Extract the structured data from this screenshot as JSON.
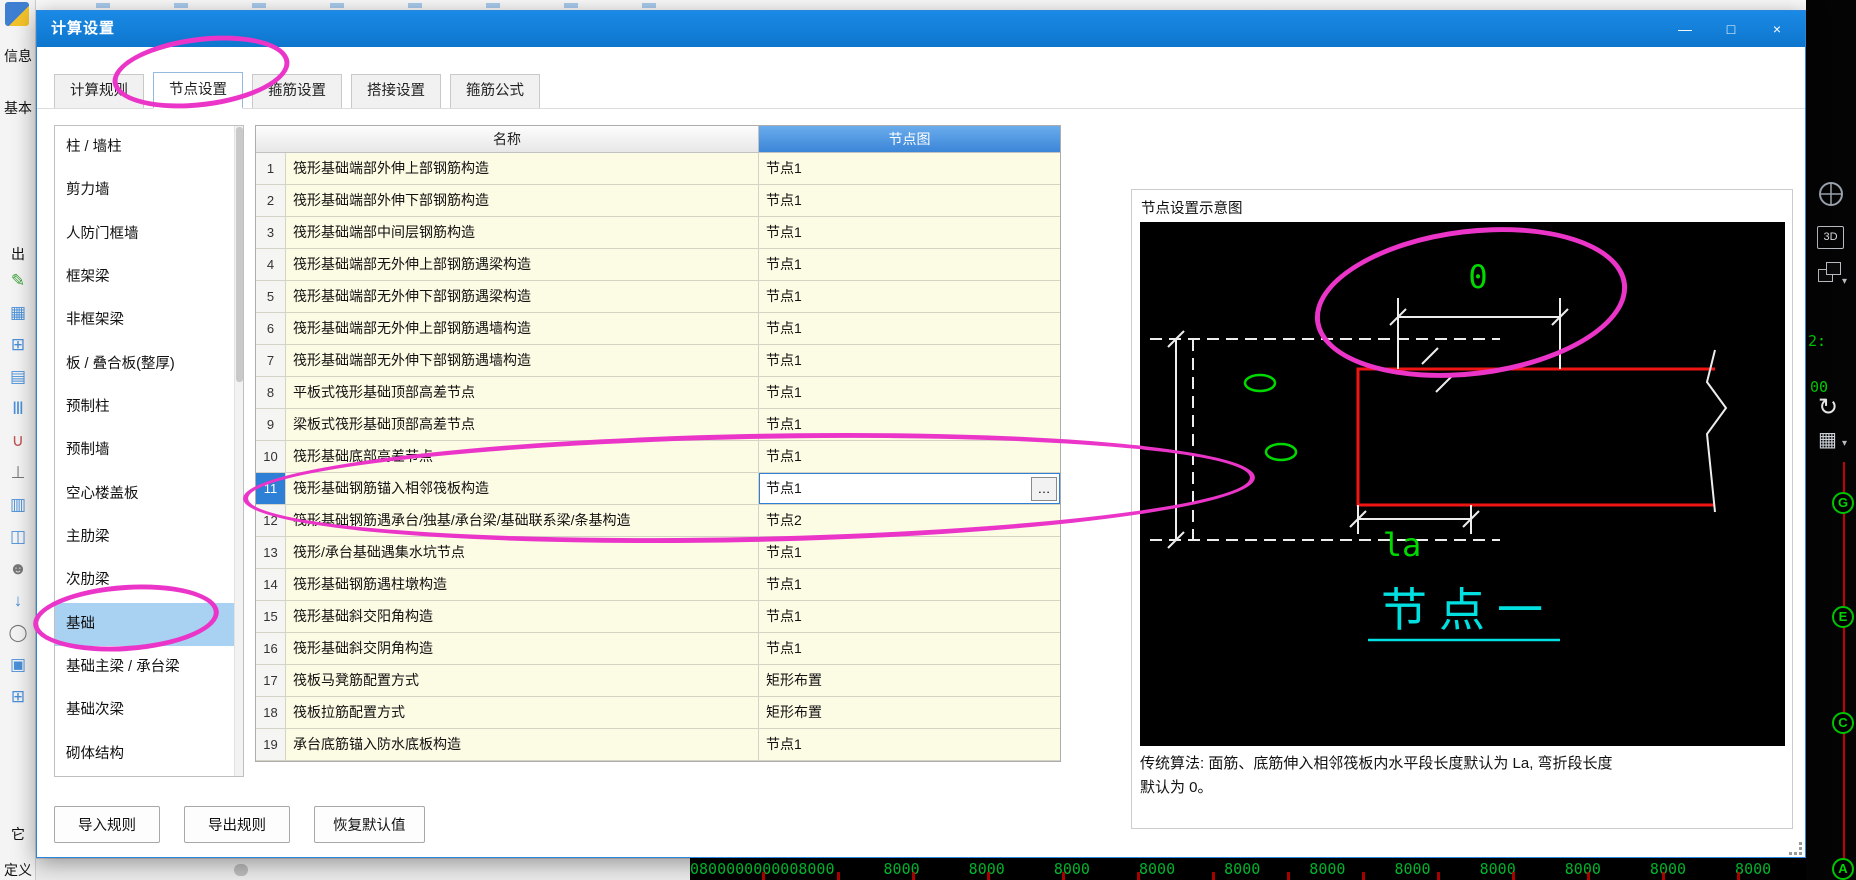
{
  "colors": {
    "titlebar": "#1583dc",
    "selection": "#2e7fd6",
    "node_column_header": "#4d97e3",
    "row_background": "#fcfbe4",
    "annotation": "#ea35c8"
  },
  "window": {
    "title": "计算设置",
    "min_glyph": "—",
    "max_glyph": "□",
    "close_glyph": "×"
  },
  "tabs": {
    "labels": [
      "计算规则",
      "节点设置",
      "箍筋设置",
      "搭接设置",
      "箍筋公式"
    ],
    "active_index": 1
  },
  "sidebar": {
    "items": [
      "柱 / 墙柱",
      "剪力墙",
      "人防门框墙",
      "框架梁",
      "非框架梁",
      "板 / 叠合板(整厚)",
      "预制柱",
      "预制墙",
      "空心楼盖板",
      "主肋梁",
      "次肋梁",
      "基础",
      "基础主梁 / 承台梁",
      "基础次梁",
      "砌体结构"
    ],
    "selected_index": 11
  },
  "table": {
    "header_name": "名称",
    "header_node": "节点图",
    "selected_row": 11,
    "ellipsis_glyph": "…",
    "rows": [
      {
        "num": 1,
        "name": "筏形基础端部外伸上部钢筋构造",
        "value": "节点1"
      },
      {
        "num": 2,
        "name": "筏形基础端部外伸下部钢筋构造",
        "value": "节点1"
      },
      {
        "num": 3,
        "name": "筏形基础端部中间层钢筋构造",
        "value": "节点1"
      },
      {
        "num": 4,
        "name": "筏形基础端部无外伸上部钢筋遇梁构造",
        "value": "节点1"
      },
      {
        "num": 5,
        "name": "筏形基础端部无外伸下部钢筋遇梁构造",
        "value": "节点1"
      },
      {
        "num": 6,
        "name": "筏形基础端部无外伸上部钢筋遇墙构造",
        "value": "节点1"
      },
      {
        "num": 7,
        "name": "筏形基础端部无外伸下部钢筋遇墙构造",
        "value": "节点1"
      },
      {
        "num": 8,
        "name": "平板式筏形基础顶部高差节点",
        "value": "节点1"
      },
      {
        "num": 9,
        "name": "梁板式筏形基础顶部高差节点",
        "value": "节点1"
      },
      {
        "num": 10,
        "name": "筏形基础底部高差节点",
        "value": "节点1"
      },
      {
        "num": 11,
        "name": "筏形基础钢筋锚入相邻筏板构造",
        "value": "节点1"
      },
      {
        "num": 12,
        "name": "筏形基础钢筋遇承台/独基/承台梁/基础联系梁/条基构造",
        "value": "节点2"
      },
      {
        "num": 13,
        "name": "筏形/承台基础遇集水坑节点",
        "value": "节点1"
      },
      {
        "num": 14,
        "name": "筏形基础钢筋遇柱墩构造",
        "value": "节点1"
      },
      {
        "num": 15,
        "name": "筏形基础斜交阳角构造",
        "value": "节点1"
      },
      {
        "num": 16,
        "name": "筏形基础斜交阴角构造",
        "value": "节点1"
      },
      {
        "num": 17,
        "name": "筏板马凳筋配置方式",
        "value": "矩形布置"
      },
      {
        "num": 18,
        "name": "筏板拉筋配置方式",
        "value": "矩形布置"
      },
      {
        "num": 19,
        "name": "承台底筋锚入防水底板构造",
        "value": "节点1"
      }
    ]
  },
  "preview": {
    "title": "节点设置示意图",
    "diagram": {
      "dim_top": "0",
      "dim_span": "la",
      "node_name": "节点一"
    },
    "description_line1": "传统算法: 面筋、底筋伸入相邻筏板内水平段长度默认为 La, 弯折段长度",
    "description_line2": "默认为 0。"
  },
  "footer": {
    "buttons": [
      {
        "name": "import-rules-button",
        "label": "导入规则"
      },
      {
        "name": "export-rules-button",
        "label": "导出规则"
      },
      {
        "name": "restore-defaults-button",
        "label": "恢复默认值"
      }
    ]
  },
  "left_toolbar": {
    "labels": {
      "info": "信息",
      "basic": "基本",
      "out": "出",
      "other": "它",
      "define": "定义"
    },
    "tools": [
      {
        "name": "pencil-icon",
        "glyph": "✎",
        "color": "#3aa13a"
      },
      {
        "name": "grid-icon",
        "glyph": "▦",
        "color": "#4a90d9"
      },
      {
        "name": "add-grid-icon",
        "glyph": "⊞",
        "color": "#4a90d9"
      },
      {
        "name": "panel-icon",
        "glyph": "▤",
        "color": "#4a90d9"
      },
      {
        "name": "columns-icon",
        "glyph": "Ⅲ",
        "color": "#4a90d9"
      },
      {
        "name": "magnet-icon",
        "glyph": "∪",
        "color": "#c05050"
      },
      {
        "name": "ground-icon",
        "glyph": "⊥",
        "color": "#777777"
      },
      {
        "name": "hatch-icon",
        "glyph": "▥",
        "color": "#4a90d9"
      },
      {
        "name": "window-icon",
        "glyph": "◫",
        "color": "#4a90d9"
      },
      {
        "name": "person-icon",
        "glyph": "☻",
        "color": "#777777"
      },
      {
        "name": "pin-icon",
        "glyph": "↓",
        "color": "#4a90d9"
      },
      {
        "name": "circle-tool-icon",
        "glyph": "◯",
        "color": "#777777"
      },
      {
        "name": "box-icon",
        "glyph": "▣",
        "color": "#4a90d9"
      },
      {
        "name": "sheet-icon",
        "glyph": "⊞",
        "color": "#4a90d9"
      }
    ]
  },
  "cad": {
    "partial_texts": [
      "2:",
      "00"
    ],
    "grid_labels": [
      "G",
      "E",
      "C",
      "A"
    ],
    "cube_label": "3D",
    "refresh_glyph": "↻",
    "sheet_glyph": "▦",
    "ruler_numbers": "0800000000008000 8000 8000 8000 8000 8000 8000 8000 8000 8000 8000 8000"
  }
}
